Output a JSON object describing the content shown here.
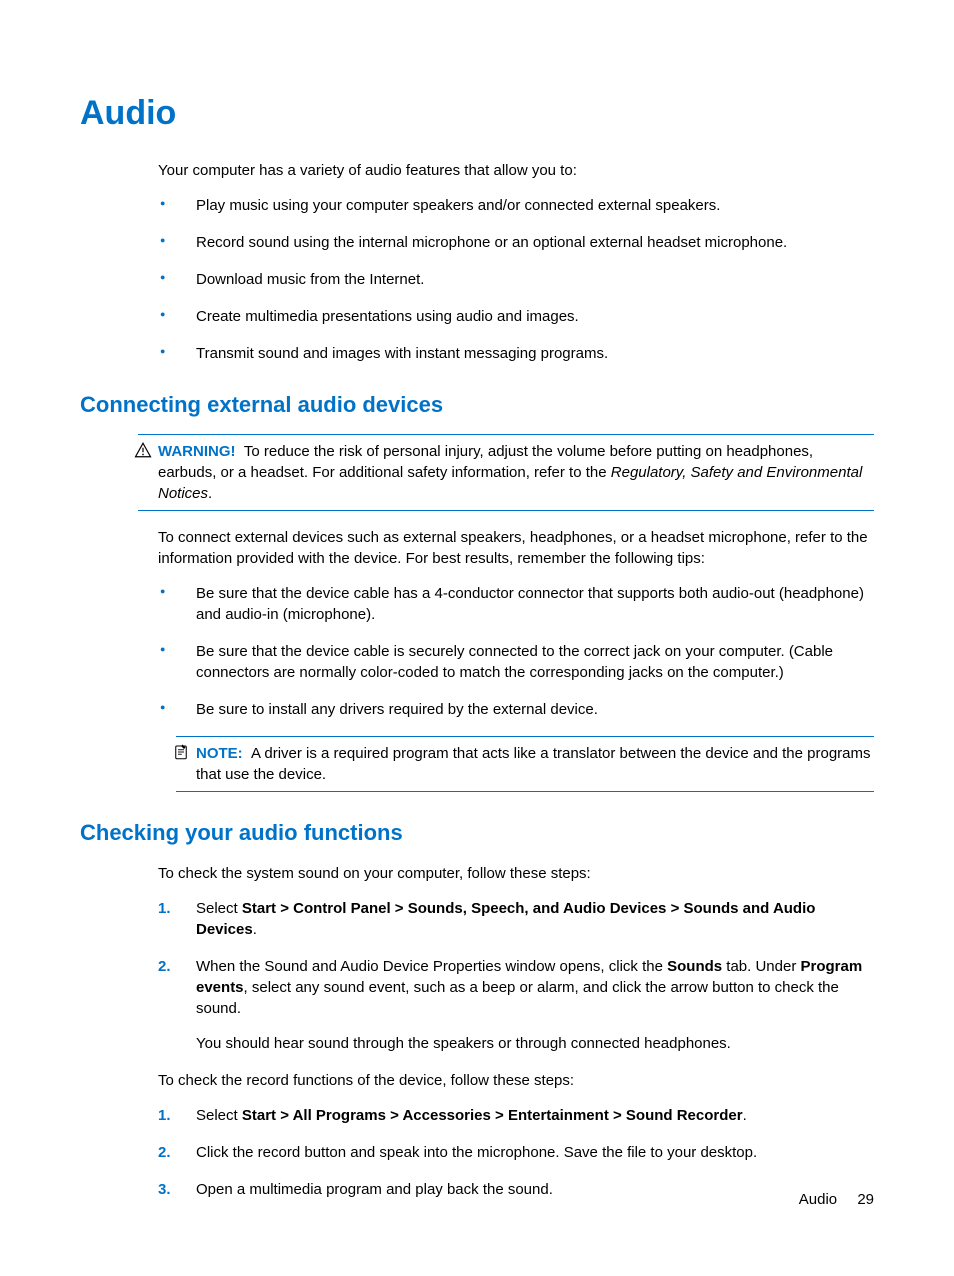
{
  "h1": "Audio",
  "intro": "Your computer has a variety of audio features that allow you to:",
  "introBullets": [
    "Play music using your computer speakers and/or connected external speakers.",
    "Record sound using the internal microphone or an optional external headset microphone.",
    "Download music from the Internet.",
    "Create multimedia presentations using audio and images.",
    "Transmit sound and images with instant messaging programs."
  ],
  "sectionA": {
    "heading": "Connecting external audio devices",
    "warningLabel": "WARNING!",
    "warningPre": "To reduce the risk of personal injury, adjust the volume before putting on headphones, earbuds, or a headset. For additional safety information, refer to the ",
    "warningItalic": "Regulatory, Safety and Environmental Notices",
    "warningPost": ".",
    "para": "To connect external devices such as external speakers, headphones, or a headset microphone, refer to the information provided with the device. For best results, remember the following tips:",
    "bullets": [
      "Be sure that the device cable has a 4-conductor connector that supports both audio-out (headphone) and audio-in (microphone).",
      "Be sure that the device cable is securely connected to the correct jack on your computer. (Cable connectors are normally color-coded to match the corresponding jacks on the computer.)",
      "Be sure to install any drivers required by the external device."
    ],
    "noteLabel": "NOTE:",
    "noteText": "A driver is a required program that acts like a translator between the device and the programs that use the device."
  },
  "sectionB": {
    "heading": "Checking your audio functions",
    "para1": "To check the system sound on your computer, follow these steps:",
    "steps1": [
      {
        "num": "1.",
        "pre": "Select ",
        "bold": "Start > Control Panel > Sounds, Speech, and Audio Devices > Sounds and Audio Devices",
        "post": "."
      },
      {
        "num": "2.",
        "pre": "When the Sound and Audio Device Properties window opens, click the ",
        "bold": "Sounds",
        "post": " tab. Under ",
        "bold2": "Program events",
        "post2": ", select any sound event, such as a beep or alarm, and click the arrow button to check the sound.",
        "extra": "You should hear sound through the speakers or through connected headphones."
      }
    ],
    "para2": "To check the record functions of the device, follow these steps:",
    "steps2": [
      {
        "num": "1.",
        "pre": "Select ",
        "bold": "Start > All Programs > Accessories > Entertainment > Sound Recorder",
        "post": "."
      },
      {
        "num": "2.",
        "text": "Click the record button and speak into the microphone. Save the file to your desktop."
      },
      {
        "num": "3.",
        "text": "Open a multimedia program and play back the sound."
      }
    ]
  },
  "footer": {
    "section": "Audio",
    "page": "29"
  }
}
